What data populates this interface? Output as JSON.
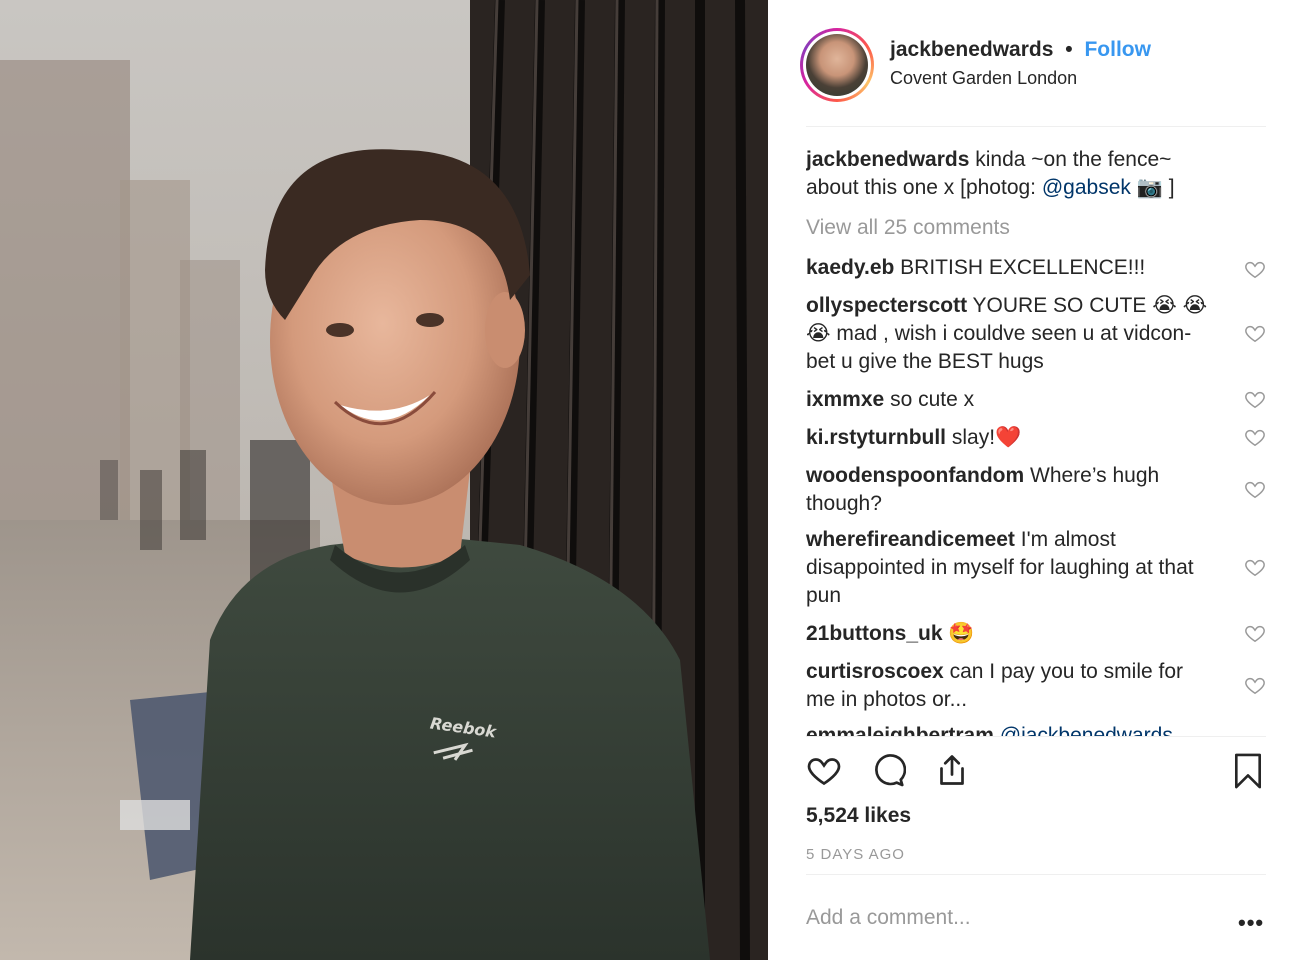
{
  "post": {
    "username": "jackbenedwards",
    "follow_label": "Follow",
    "location": "Covent Garden London",
    "caption_text": "kinda ~on the fence~ about this one x [photog: ",
    "caption_mention": "@gabsek",
    "caption_end": " 📷 ]",
    "view_all": "View all 25 comments",
    "likes": "5,524 likes",
    "time_ago": "5 DAYS AGO",
    "add_comment_placeholder": "Add a comment...",
    "more_label": "•••"
  },
  "photo": {
    "brand_text": "Reebok"
  },
  "comments": [
    {
      "user": "kaedy.eb",
      "text": "BRITISH EXCELLENCE!!!"
    },
    {
      "user": "ollyspecterscott",
      "text": "YOURE SO CUTE 😭 😭 😭  mad , wish i couldve seen u at vidcon- bet u give the BEST hugs"
    },
    {
      "user": "ixmmxe",
      "text": "so cute x"
    },
    {
      "user": "ki.rstyturnbull",
      "text": "slay!❤️"
    },
    {
      "user": "woodenspoonfandom",
      "text": "Where’s hugh though?"
    },
    {
      "user": "wherefireandicemeet",
      "text": "I'm almost disappointed in myself for laughing at that pun"
    },
    {
      "user": "21buttons_uk",
      "text": "🤩"
    },
    {
      "user": "curtisroscoex",
      "text": "can I pay you to smile for me in photos or..."
    },
    {
      "user": "emmaleighbertram",
      "text": "@jackbenedwards"
    }
  ],
  "colors": {
    "link": "#3897f0",
    "text": "#262626",
    "muted": "#999999",
    "heart_like": "#ed4956"
  },
  "icons": [
    "heart-icon",
    "comment-icon",
    "share-icon",
    "bookmark-icon",
    "more-icon"
  ]
}
